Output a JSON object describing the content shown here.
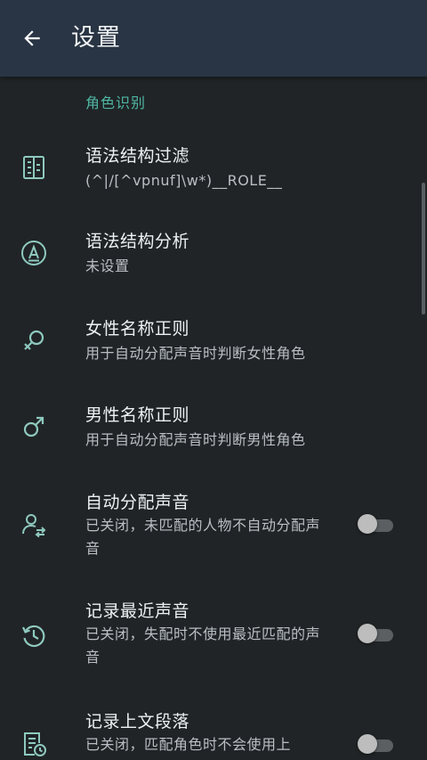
{
  "appbar": {
    "title": "设置",
    "back_icon": "arrow-left-icon"
  },
  "section": {
    "header": "角色识别"
  },
  "colors": {
    "appbar_bg": "#293544",
    "background": "#202426",
    "accent": "#4fb6a4",
    "icon": "#8ec9bf"
  },
  "items": [
    {
      "title": "语法结构过滤",
      "subtitle": "(^|/[^vpnuf]\\w*)__ROLE__",
      "icon": "filter-structure-icon"
    },
    {
      "title": "语法结构分析",
      "subtitle": "未设置",
      "icon": "circle-a-icon"
    },
    {
      "title": "女性名称正则",
      "subtitle": "用于自动分配声音时判断女性角色",
      "icon": "female-icon"
    },
    {
      "title": "男性名称正则",
      "subtitle": "用于自动分配声音时判断男性角色",
      "icon": "male-icon"
    },
    {
      "title": "自动分配声音",
      "subtitle": "已关闭，未匹配的人物不自动分配声音",
      "icon": "person-swap-icon",
      "toggle": false
    },
    {
      "title": "记录最近声音",
      "subtitle": "已关闭，失配时不使用最近匹配的声音",
      "icon": "history-icon",
      "toggle": false
    },
    {
      "title": "记录上文段落",
      "subtitle": "已关闭，匹配角色时不会使用上",
      "icon": "document-clock-icon",
      "toggle": false
    }
  ]
}
